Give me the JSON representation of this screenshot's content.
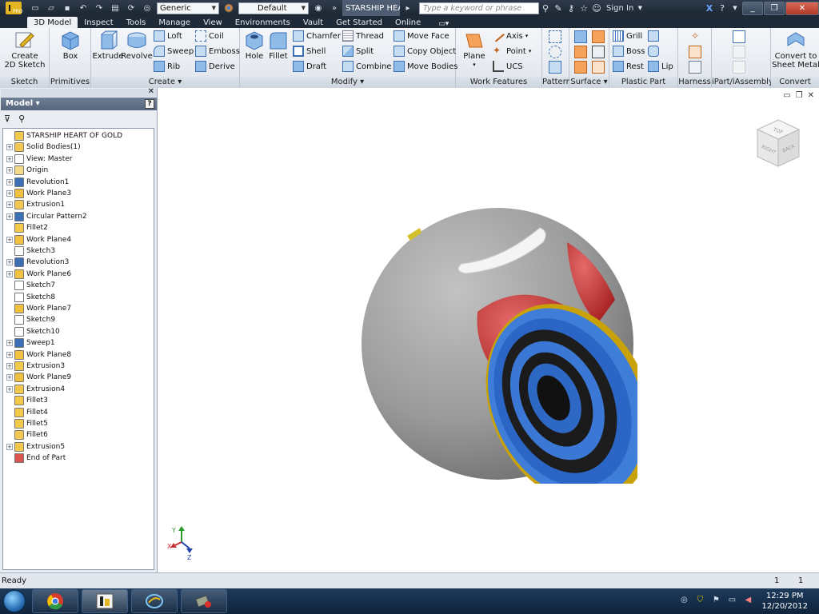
{
  "titlebar": {
    "app_button": "PRO",
    "combo_material": "Generic",
    "combo_appearance": "Default",
    "doc_title": "STARSHIP HEA...",
    "search_placeholder": "Type a keyword or phrase",
    "sign_in": "Sign In",
    "icons": [
      "new-icon",
      "open-icon",
      "save-icon",
      "undo-icon",
      "redo-icon",
      "print-icon",
      "update-icon",
      "return-icon",
      "properties-icon"
    ]
  },
  "tabs": [
    "3D Model",
    "Inspect",
    "Tools",
    "Manage",
    "View",
    "Environments",
    "Vault",
    "Get Started",
    "Online"
  ],
  "ribbon": {
    "sketch": {
      "title": "Sketch",
      "create_sketch": "Create\n2D Sketch"
    },
    "primitives": {
      "title": "Primitives",
      "box": "Box"
    },
    "create": {
      "title": "Create",
      "extrude": "Extrude",
      "revolve": "Revolve",
      "loft": "Loft",
      "sweep": "Sweep",
      "rib": "Rib",
      "coil": "Coil",
      "emboss": "Emboss",
      "derive": "Derive"
    },
    "modify": {
      "title": "Modify",
      "hole": "Hole",
      "fillet": "Fillet",
      "chamfer": "Chamfer",
      "shell": "Shell",
      "draft": "Draft",
      "thread": "Thread",
      "split": "Split",
      "combine": "Combine",
      "move_face": "Move Face",
      "copy_object": "Copy Object",
      "move_bodies": "Move Bodies"
    },
    "work_features": {
      "title": "Work Features",
      "plane": "Plane",
      "axis": "Axis",
      "point": "Point",
      "ucs": "UCS"
    },
    "pattern": {
      "title": "Pattern"
    },
    "surface": {
      "title": "Surface"
    },
    "plastic_part": {
      "title": "Plastic Part",
      "grill": "Grill",
      "boss": "Boss",
      "rest": "Rest",
      "lip": "Lip"
    },
    "harness": {
      "title": "Harness"
    },
    "ipart": {
      "title": "iPart/iAssembly"
    },
    "convert": {
      "title": "Convert",
      "sheet_metal": "Convert to\nSheet Metal"
    }
  },
  "browser": {
    "title": "Model",
    "help": "?",
    "tree": [
      {
        "label": "STARSHIP HEART OF GOLD",
        "icon": "part-icon",
        "expandable": false,
        "color": "#f2c94c"
      },
      {
        "label": "Solid Bodies(1)",
        "icon": "solid-bodies-icon",
        "expandable": true,
        "color": "#f2c94c"
      },
      {
        "label": "View: Master",
        "icon": "view-icon",
        "expandable": true,
        "color": "#ffffff"
      },
      {
        "label": "Origin",
        "icon": "folder-icon",
        "expandable": true,
        "color": "#f5d98a"
      },
      {
        "label": "Revolution1",
        "icon": "revolve-icon",
        "expandable": true,
        "color": "#3b6fb6"
      },
      {
        "label": "Work Plane3",
        "icon": "work-plane-icon",
        "expandable": true,
        "color": "#f0c040"
      },
      {
        "label": "Extrusion1",
        "icon": "extrude-icon",
        "expandable": true,
        "color": "#f2c94c"
      },
      {
        "label": "Circular Pattern2",
        "icon": "circular-pattern-icon",
        "expandable": true,
        "color": "#3b6fb6"
      },
      {
        "label": "Fillet2",
        "icon": "fillet-icon",
        "expandable": false,
        "color": "#f2c94c"
      },
      {
        "label": "Work Plane4",
        "icon": "work-plane-icon",
        "expandable": true,
        "color": "#f0c040"
      },
      {
        "label": "Sketch3",
        "icon": "sketch-icon",
        "expandable": false,
        "color": "#ffffff"
      },
      {
        "label": "Revolution3",
        "icon": "revolve-icon",
        "expandable": true,
        "color": "#3b6fb6"
      },
      {
        "label": "Work Plane6",
        "icon": "work-plane-icon",
        "expandable": true,
        "color": "#f0c040"
      },
      {
        "label": "Sketch7",
        "icon": "sketch-icon",
        "expandable": false,
        "color": "#ffffff"
      },
      {
        "label": "Sketch8",
        "icon": "sketch-icon",
        "expandable": false,
        "color": "#ffffff"
      },
      {
        "label": "Work Plane7",
        "icon": "work-plane-icon",
        "expandable": false,
        "color": "#f0c040"
      },
      {
        "label": "Sketch9",
        "icon": "sketch-icon",
        "expandable": false,
        "color": "#ffffff"
      },
      {
        "label": "Sketch10",
        "icon": "sketch-icon",
        "expandable": false,
        "color": "#ffffff"
      },
      {
        "label": "Sweep1",
        "icon": "sweep-icon",
        "expandable": true,
        "color": "#3b6fb6"
      },
      {
        "label": "Work Plane8",
        "icon": "work-plane-icon",
        "expandable": true,
        "color": "#f0c040"
      },
      {
        "label": "Extrusion3",
        "icon": "extrude-icon",
        "expandable": true,
        "color": "#f2c94c"
      },
      {
        "label": "Work Plane9",
        "icon": "work-plane-icon",
        "expandable": true,
        "color": "#f0c040"
      },
      {
        "label": "Extrusion4",
        "icon": "extrude-icon",
        "expandable": true,
        "color": "#f2c94c"
      },
      {
        "label": "Fillet3",
        "icon": "fillet-icon",
        "expandable": false,
        "color": "#f2c94c"
      },
      {
        "label": "Fillet4",
        "icon": "fillet-icon",
        "expandable": false,
        "color": "#f2c94c"
      },
      {
        "label": "Fillet5",
        "icon": "fillet-icon",
        "expandable": false,
        "color": "#f2c94c"
      },
      {
        "label": "Fillet6",
        "icon": "fillet-icon",
        "expandable": false,
        "color": "#f2c94c"
      },
      {
        "label": "Extrusion5",
        "icon": "extrude-icon",
        "expandable": true,
        "color": "#f2c94c"
      },
      {
        "label": "End of Part",
        "icon": "end-of-part-icon",
        "expandable": false,
        "color": "#d9534f"
      }
    ]
  },
  "viewcube": {
    "faces": [
      "TOP",
      "RIGHT",
      "BACK"
    ]
  },
  "triad": {
    "x": "X",
    "y": "Y",
    "z": "Z"
  },
  "statusbar": {
    "text": "Ready",
    "count1": "1",
    "count2": "1"
  },
  "taskbar": {
    "apps": [
      "chrome-icon",
      "inventor-icon",
      "vault-icon",
      "tool-icon"
    ],
    "time": "12:29 PM",
    "date": "12/20/2012"
  }
}
